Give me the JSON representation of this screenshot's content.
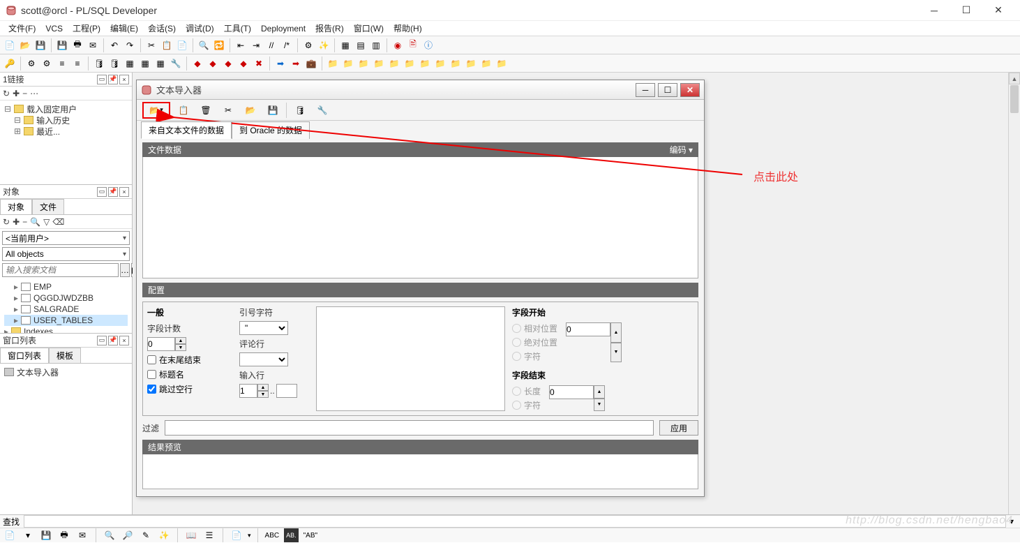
{
  "window": {
    "title": "scott@orcl - PL/SQL Developer"
  },
  "menu": {
    "file": "文件(F)",
    "vcs": "VCS",
    "project": "工程(P)",
    "edit": "编辑(E)",
    "session": "会话(S)",
    "debug": "调试(D)",
    "tools": "工具(T)",
    "deployment": "Deployment",
    "report": "报告(R)",
    "window": "窗口(W)",
    "help": "帮助(H)"
  },
  "left": {
    "connections_title": "1链接",
    "connections": {
      "n1": "载入固定用户",
      "n2": "输入历史",
      "n3": "最近..."
    },
    "objects_title": "对象",
    "tab_objects": "对象",
    "tab_files": "文件",
    "user_combo": "<当前用户>",
    "filter_combo": "All objects",
    "search_placeholder": "输入搜索文档",
    "tree": {
      "t1": "EMP",
      "t2": "QGGDJWDZBB",
      "t3": "SALGRADE",
      "t4": "USER_TABLES",
      "t5": "Indexes"
    },
    "winlist_title": "窗口列表",
    "tab_winlist": "窗口列表",
    "tab_template": "模板",
    "winlist_item": "文本导入器"
  },
  "mdi": {
    "title": "文本导入器",
    "tab1": "来自文本文件的数据",
    "tab2": "到 Oracle 的数据",
    "sec_filedata": "文件数据",
    "encoding": "编码",
    "sec_config": "配置",
    "general": "一般",
    "field_count": "字段计数",
    "field_count_val": "0",
    "end_trim": "在末尾结束",
    "title_row": "标题名",
    "skip_blank": "跳过空行",
    "quote_char": "引号字符",
    "quote_val": "\"",
    "comment_line": "评论行",
    "input_lines": "输入行",
    "input_lines_val": "1",
    "field_start": "字段开始",
    "rel_pos": "相对位置",
    "abs_pos": "绝对位置",
    "char_opt": "字符",
    "fs_val": "0",
    "field_end": "字段结束",
    "length": "长度",
    "fe_val": "0",
    "filter": "过滤",
    "apply": "应用",
    "sec_result": "结果预览"
  },
  "status": {
    "find_label": "查找",
    "abc": "ABC",
    "ab": "\"AB\""
  },
  "annotation": {
    "text": "点击此处"
  },
  "watermark": "http://blog.csdn.net/hengbao4"
}
